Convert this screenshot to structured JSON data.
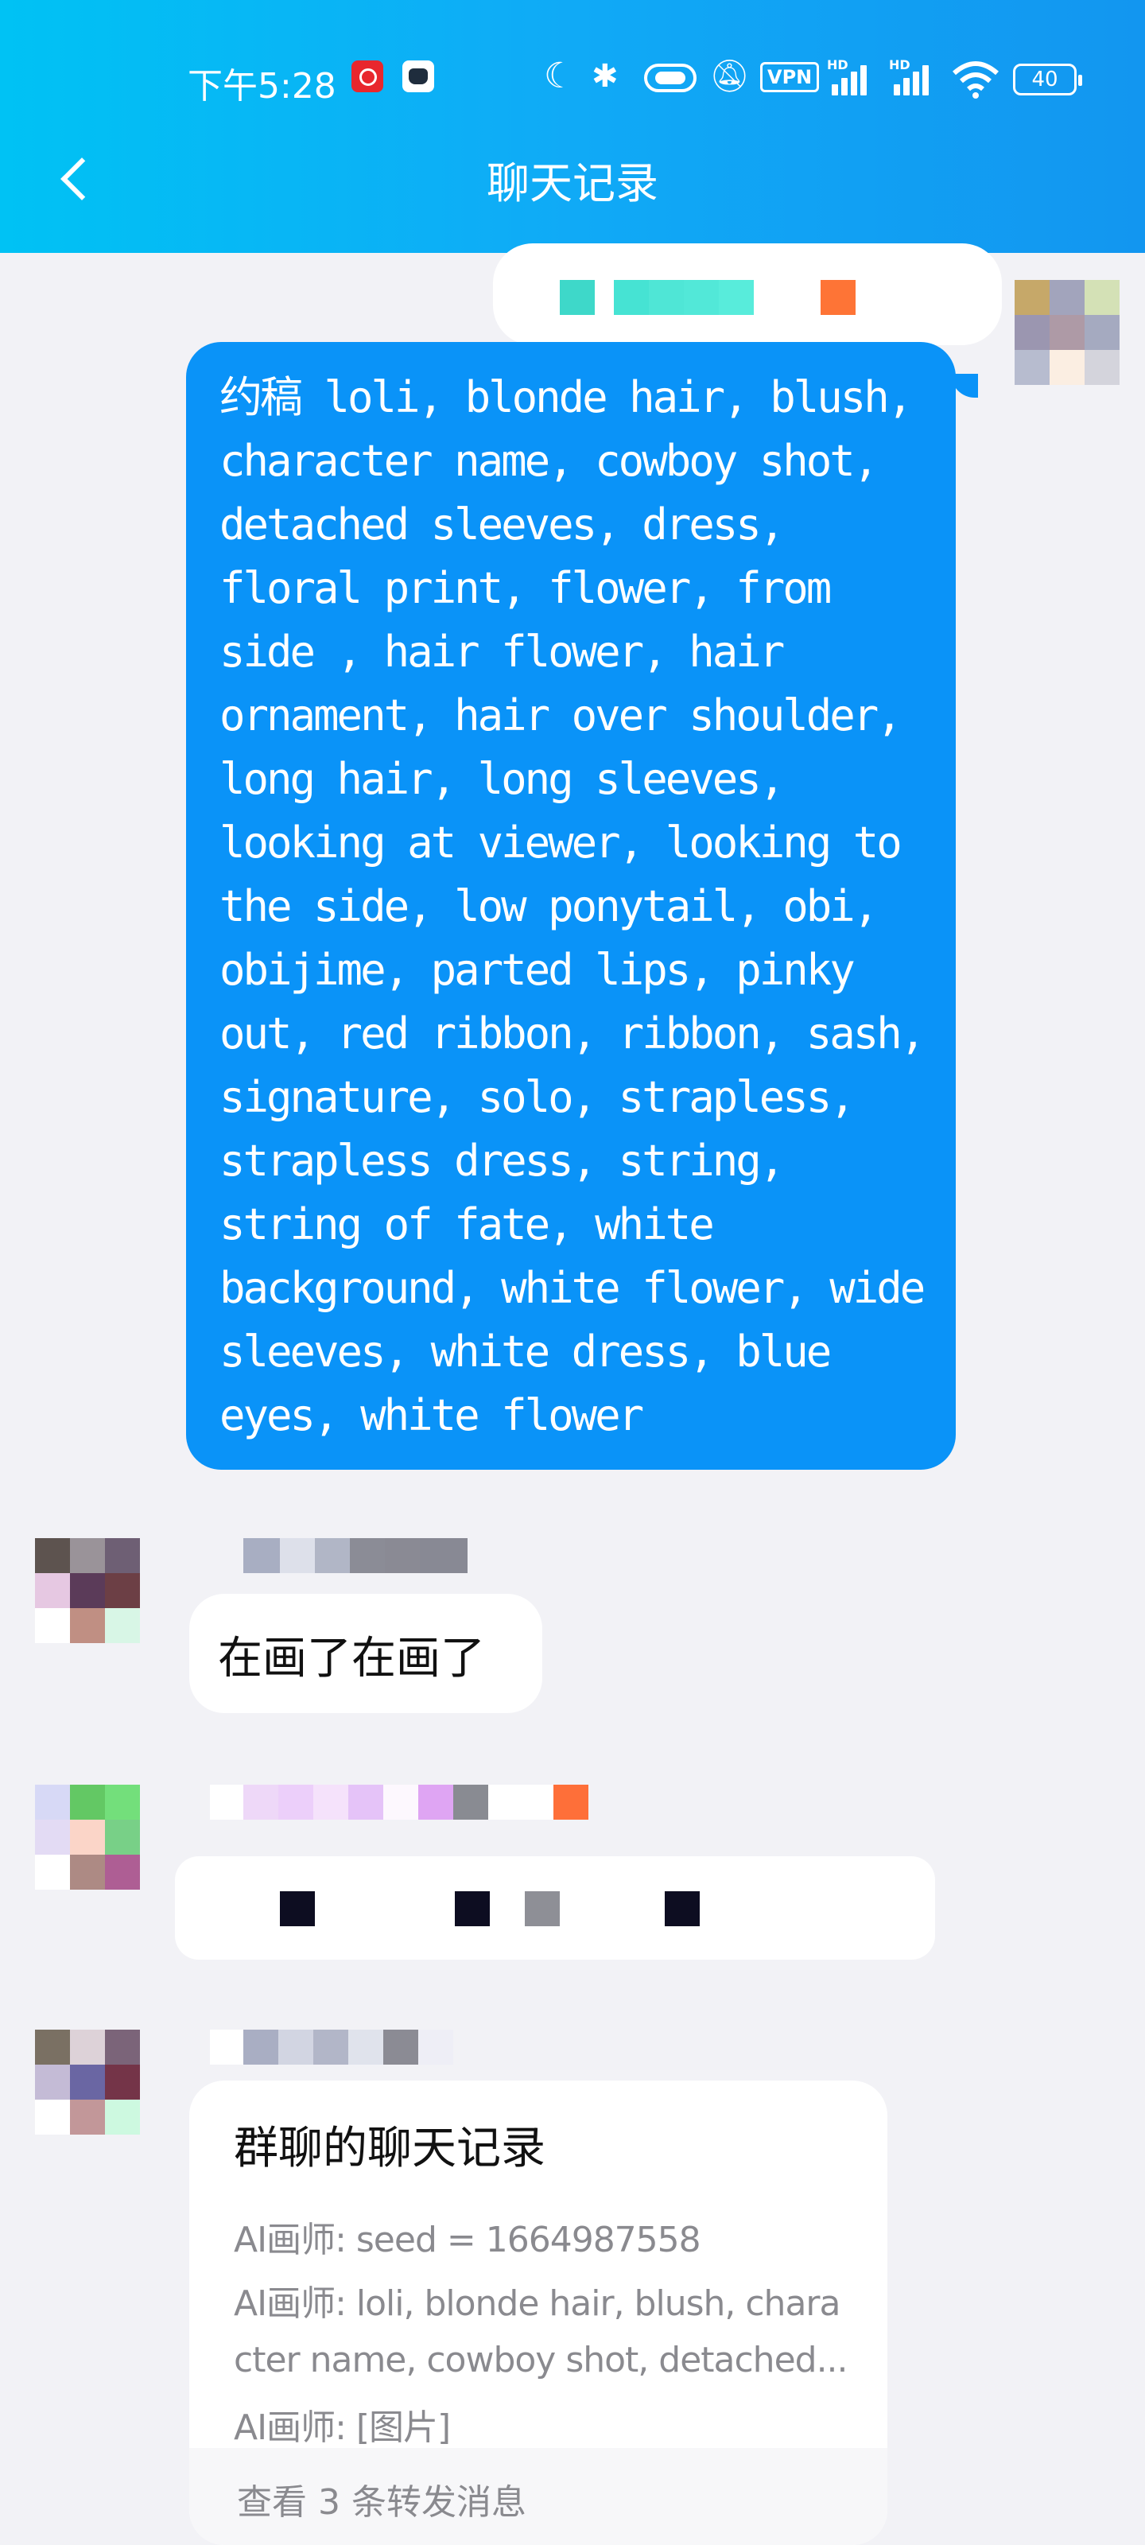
{
  "status_bar": {
    "time": "下午5:28",
    "vpn": "VPN",
    "signal_label": "HD",
    "battery": "40",
    "icons": [
      "netease-music-icon",
      "cat-app-icon",
      "moon-icon",
      "bluetooth-icon",
      "vibrate-icon",
      "mute-bell-icon",
      "signal-icon",
      "wifi-icon",
      "battery-icon"
    ]
  },
  "header": {
    "title": "聊天记录",
    "back_icon": "chevron-left-icon"
  },
  "colors": {
    "header_gradient": [
      "#00c2f4",
      "#1296f0"
    ],
    "sent_bubble": "#0a93f8",
    "background": "#f2f2f6",
    "received_bubble": "#ffffff"
  },
  "messages": [
    {
      "direction": "sent",
      "sender_name_visible": false,
      "text": "约稿 loli, blonde hair, blush, character name, cowboy shot,  detached sleeves, dress, floral print, flower, from side , hair flower, hair ornament, hair over shoulder, long hair, long sleeves, looking at viewer, looking to the side, low ponytail, obi, obijime, parted lips, pinky out, red ribbon, ribbon, sash, signature, solo, strapless, strapless dress, string, string of fate, white background, white flower, wide sleeves, white dress, blue eyes, white flower"
    },
    {
      "direction": "received",
      "sender_name_visible": false,
      "text": "在画了在画了"
    },
    {
      "direction": "received",
      "sender_name_visible": false,
      "text": "",
      "note": "content pixelated"
    },
    {
      "direction": "received",
      "sender_name_visible": false,
      "forward_card": {
        "title": "群聊的聊天记录",
        "lines": [
          "AI画师: seed = 1664987558",
          "AI画师: loli, blonde hair, blush, chara",
          "cter name, cowboy shot, detached...",
          "AI画师: [图片]"
        ],
        "footer": "查看 3 条转发消息"
      }
    }
  ]
}
